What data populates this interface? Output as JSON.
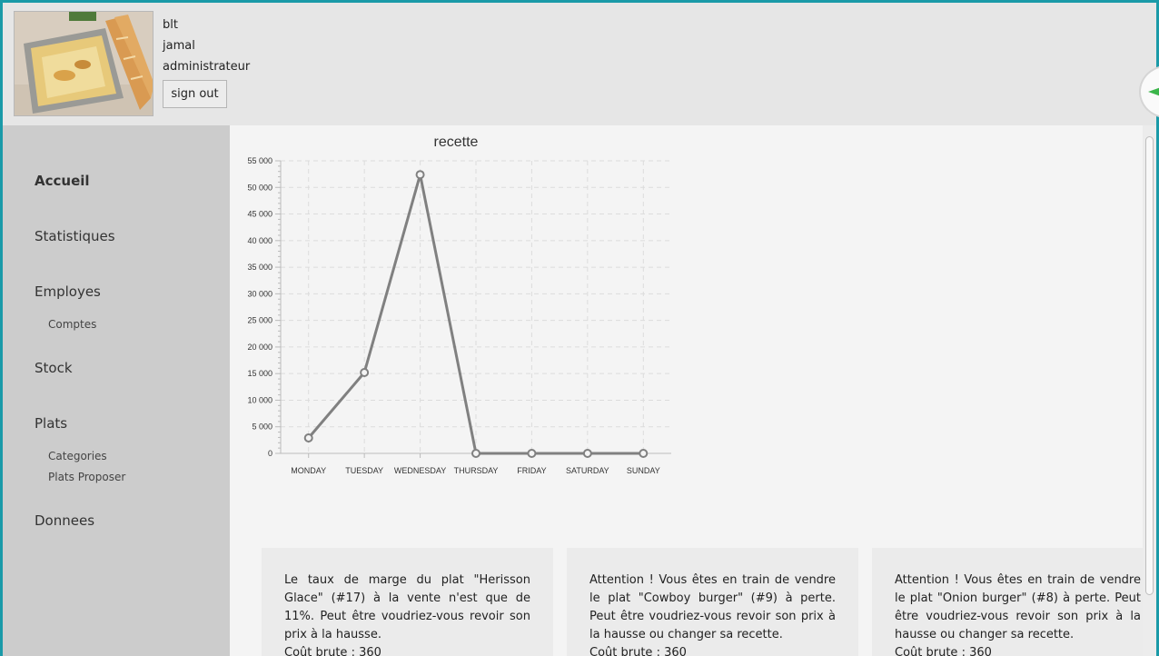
{
  "header": {
    "user_lines": [
      "blt",
      "jamal",
      "administrateur"
    ],
    "signout_label": "sign out"
  },
  "sidebar": {
    "items": [
      {
        "label": "Accueil"
      },
      {
        "label": "Statistiques"
      },
      {
        "label": "Employes"
      },
      {
        "label": "Comptes"
      },
      {
        "label": "Stock"
      },
      {
        "label": "Plats"
      },
      {
        "label": "Categories"
      },
      {
        "label": "Plats Proposer"
      },
      {
        "label": "Donnees"
      }
    ]
  },
  "chart_data": {
    "type": "line",
    "title": "recette",
    "categories": [
      "MONDAY",
      "TUESDAY",
      "WEDNESDAY",
      "THURSDAY",
      "FRIDAY",
      "SATURDAY",
      "SUNDAY"
    ],
    "values": [
      2900,
      15200,
      52400,
      0,
      0,
      0,
      0
    ],
    "ylim": [
      0,
      55000
    ],
    "yticks": [
      "0",
      "5 000",
      "10 000",
      "15 000",
      "20 000",
      "25 000",
      "30 000",
      "35 000",
      "40 000",
      "45 000",
      "50 000",
      "55 000"
    ],
    "grid": true,
    "line_color": "#808080"
  },
  "cards": [
    {
      "text": "Le taux de marge du plat \"Herisson Glace\" (#17) à la vente n'est que de 11%. Peut être voudriez-vous revoir son prix à la hausse.",
      "cost": "Coût brute : 360"
    },
    {
      "text": "Attention ! Vous êtes en train de vendre le plat \"Cowboy burger\" (#9) à perte. Peut être voudriez-vous revoir son prix à la hausse ou changer sa recette.",
      "cost": "Coût brute : 360"
    },
    {
      "text": "Attention ! Vous êtes en train de vendre le plat \"Onion burger\" (#8) à perte. Peut être voudriez-vous revoir son prix à la hausse ou changer sa recette.",
      "cost": "Coût brute : 360"
    }
  ]
}
